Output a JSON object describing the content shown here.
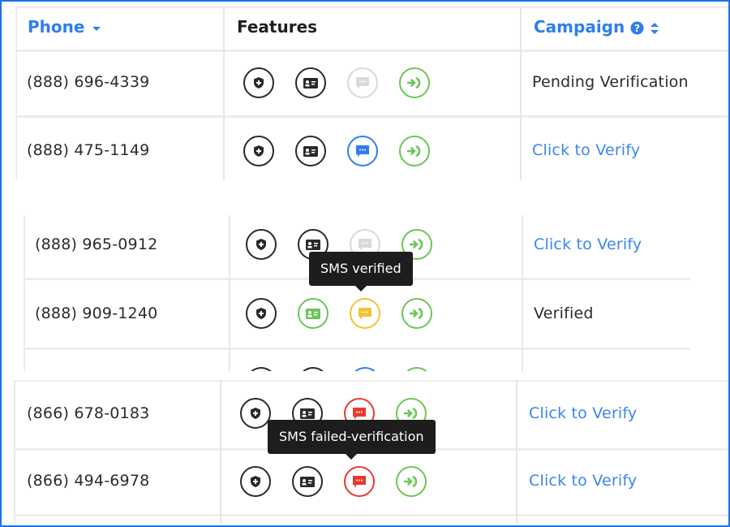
{
  "colors": {
    "frame": "#1a73e8",
    "link": "#3a86f0",
    "header_blue": "#2f7df0",
    "icon_dark": "#2a2a2a",
    "icon_gray": "#d9d9d9",
    "icon_blue": "#2f7df0",
    "icon_green": "#6cc655",
    "icon_yellow": "#f5c232",
    "icon_red": "#e83a30",
    "tooltip_bg": "#1d1d1d"
  },
  "table": {
    "headers": {
      "phone": "Phone",
      "features": "Features",
      "campaign": "Campaign"
    },
    "header_icons": {
      "phone_sort": "sort-down-icon",
      "campaign_help": "help-circle-icon",
      "campaign_sort": "sort-both-icon"
    }
  },
  "snippets": [
    {
      "rows": [
        {
          "phone": "(888) 696-4339",
          "features": {
            "shield": "dark",
            "id_card": "dark",
            "sms": "gray",
            "call_forward": "green"
          },
          "campaign": "Pending Verification",
          "campaign_is_link": false
        },
        {
          "phone": "(888) 475-1149",
          "features": {
            "shield": "dark",
            "id_card": "dark",
            "sms": "blue",
            "call_forward": "green"
          },
          "campaign": "Click to Verify",
          "campaign_is_link": true
        }
      ]
    },
    {
      "rows": [
        {
          "phone": "(888) 965-0912",
          "features": {
            "shield": "dark",
            "id_card": "dark",
            "sms": "gray",
            "call_forward": "green"
          },
          "campaign": "Click to Verify",
          "campaign_is_link": true
        },
        {
          "phone": "(888) 909-1240",
          "features": {
            "shield": "dark",
            "id_card": "green",
            "sms": "yellow",
            "call_forward": "green"
          },
          "campaign": "Verified",
          "campaign_is_link": false
        },
        {
          "phone": "",
          "features": {
            "shield": "dark",
            "id_card": "dark",
            "sms": "blue",
            "call_forward": "green"
          },
          "campaign": "",
          "campaign_is_link": false
        }
      ],
      "tooltip": "SMS verified"
    },
    {
      "rows": [
        {
          "phone": "(866) 678-0183",
          "features": {
            "shield": "dark",
            "id_card": "dark",
            "sms": "red",
            "call_forward": "green"
          },
          "campaign": "Click to Verify",
          "campaign_is_link": true
        },
        {
          "phone": "(866) 494-6978",
          "features": {
            "shield": "dark",
            "id_card": "dark",
            "sms": "red",
            "call_forward": "green"
          },
          "campaign": "Click to Verify",
          "campaign_is_link": true
        }
      ],
      "tooltip": "SMS failed-verification"
    }
  ]
}
